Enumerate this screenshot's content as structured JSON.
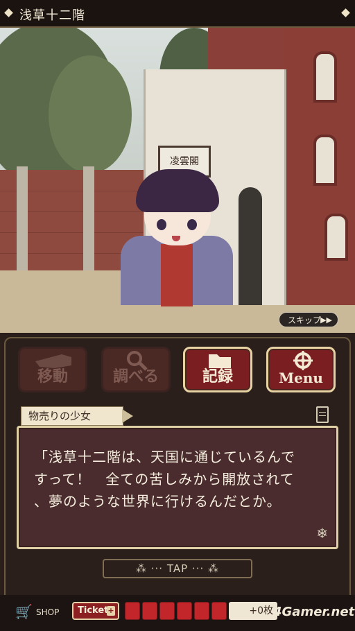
{
  "header": {
    "title": "浅草十二階"
  },
  "scene": {
    "signboard": "凌雲閣"
  },
  "skip": {
    "label": "スキップ",
    "arrows": "▶▶"
  },
  "menu": {
    "buttons": [
      {
        "label": "移動",
        "icon": "pointing-hand-icon",
        "enabled": false
      },
      {
        "label": "調べる",
        "icon": "magnifier-icon",
        "enabled": false
      },
      {
        "label": "記録",
        "icon": "folder-icon",
        "enabled": true
      },
      {
        "label": "Menu",
        "icon": "gear-icon",
        "enabled": true
      }
    ]
  },
  "dialog": {
    "speaker": "物売りの少女",
    "lines": [
      "「浅草十二階は、天国に通じているんで",
      "すって！　全ての苦しみから開放されて",
      "、夢のような世界に行けるんだとか。"
    ]
  },
  "tap": {
    "label": "TAP"
  },
  "footer": {
    "shop_label": "SHOP",
    "ticket_label": "Ticket",
    "ticket_slots": 6,
    "counter": "+0枚",
    "watermark": "4Gamer.net"
  },
  "colors": {
    "accent": "#7b1e22",
    "frame": "#dfd0a6",
    "panel": "#2a1f1b"
  }
}
